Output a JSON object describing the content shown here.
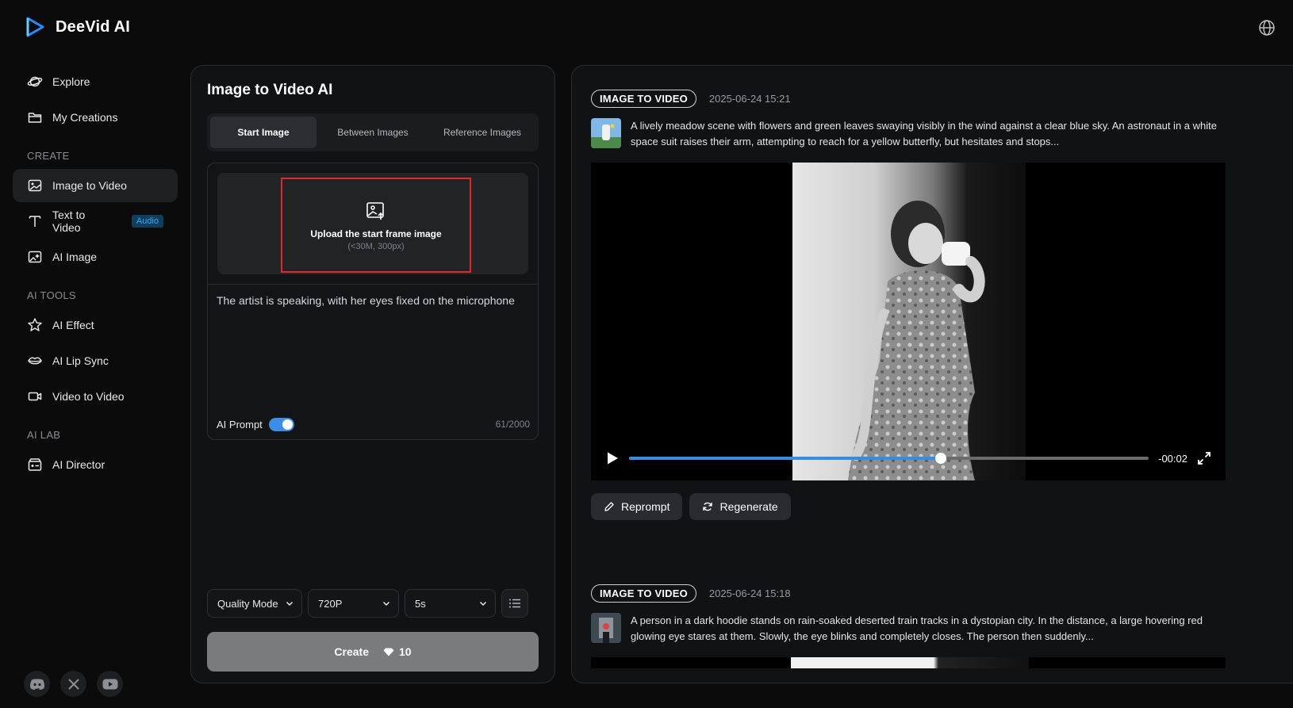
{
  "brand": {
    "name": "DeeVid AI"
  },
  "sidebar": {
    "items_top": [
      {
        "label": "Explore",
        "icon": "planet-icon"
      },
      {
        "label": "My Creations",
        "icon": "folder-icon"
      }
    ],
    "sections": [
      {
        "title": "CREATE",
        "items": [
          {
            "label": "Image to Video",
            "icon": "image-icon",
            "active": true
          },
          {
            "label": "Text to Video",
            "icon": "text-icon",
            "badge": "Audio"
          },
          {
            "label": "AI Image",
            "icon": "ai-image-icon"
          }
        ]
      },
      {
        "title": "AI TOOLS",
        "items": [
          {
            "label": "AI Effect",
            "icon": "star-icon"
          },
          {
            "label": "AI Lip Sync",
            "icon": "lips-icon"
          },
          {
            "label": "Video to Video",
            "icon": "video-camera-icon"
          }
        ]
      },
      {
        "title": "AI LAB",
        "items": [
          {
            "label": "AI Director",
            "icon": "director-icon"
          }
        ]
      }
    ],
    "socials": [
      "discord-icon",
      "x-icon",
      "youtube-icon"
    ]
  },
  "generator": {
    "title": "Image to Video AI",
    "tabs": [
      {
        "label": "Start Image",
        "active": true
      },
      {
        "label": "Between Images",
        "active": false
      },
      {
        "label": "Reference Images",
        "active": false
      }
    ],
    "upload": {
      "title": "Upload the start frame image",
      "hint": "(<30M, 300px)"
    },
    "prompt": "The artist is speaking, with her eyes fixed on the microphone",
    "ai_prompt_label": "AI Prompt",
    "ai_prompt_enabled": true,
    "char_count": "61/2000",
    "mode": "Quality Mode",
    "resolution": "720P",
    "duration": "5s",
    "create_label": "Create",
    "credits": "10"
  },
  "history": [
    {
      "type": "IMAGE TO VIDEO",
      "timestamp": "2025-06-24 15:21",
      "description": "A lively meadow scene with flowers and green leaves swaying visibly in the wind against a clear blue sky. An astronaut in a white space suit raises their arm, attempting to reach for a yellow butterfly, but hesitates and stops...",
      "video": {
        "time": "-00:02",
        "progress": 0.6
      },
      "actions": {
        "reprompt": "Reprompt",
        "regenerate": "Regenerate"
      }
    },
    {
      "type": "IMAGE TO VIDEO",
      "timestamp": "2025-06-24 15:18",
      "description": "A person in a dark hoodie stands on rain-soaked deserted train tracks in a dystopian city. In the distance, a large hovering red glowing eye stares at them. Slowly, the eye blinks and completely closes. The person then suddenly..."
    }
  ],
  "colors": {
    "accent": "#2f8fe6",
    "highlight": "#e3282a",
    "background": "#0b0b0c"
  }
}
